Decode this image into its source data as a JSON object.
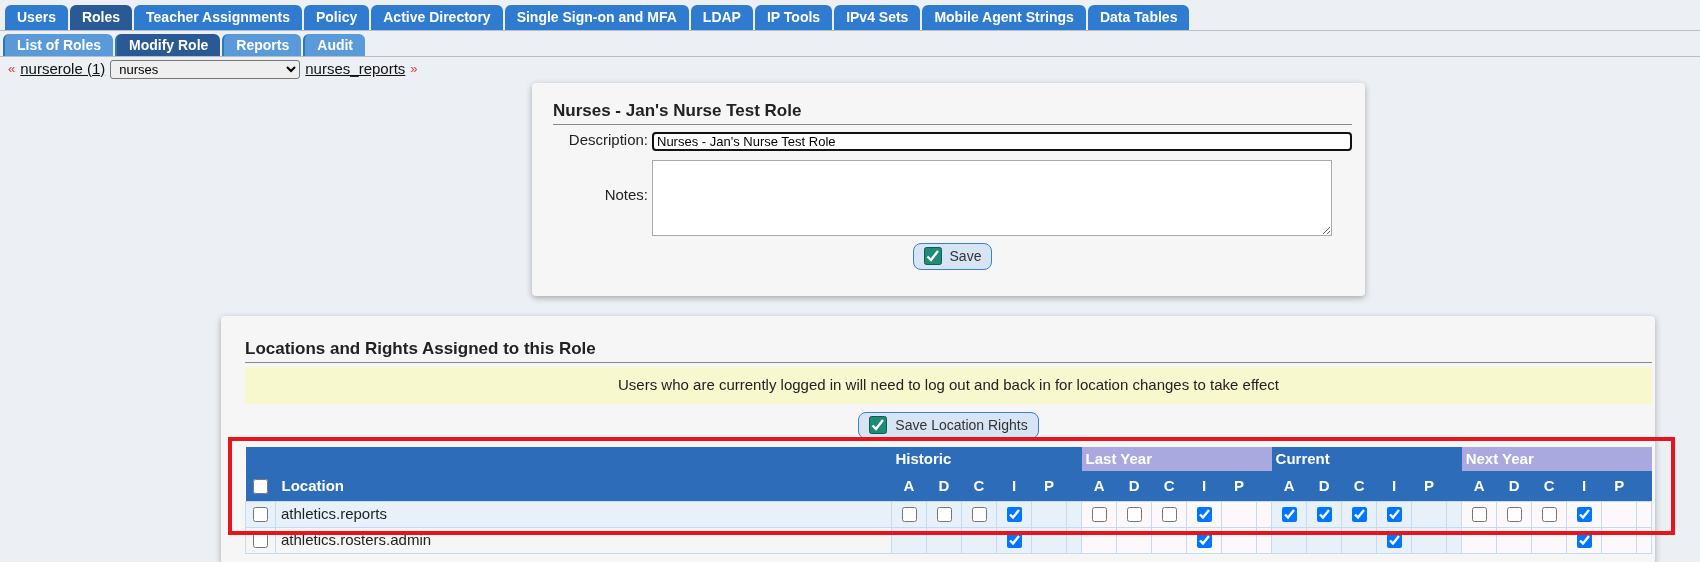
{
  "top_tabs": [
    {
      "label": "Users",
      "selected": false
    },
    {
      "label": "Roles",
      "selected": true
    },
    {
      "label": "Teacher Assignments",
      "selected": false
    },
    {
      "label": "Policy",
      "selected": false
    },
    {
      "label": "Active Directory",
      "selected": false
    },
    {
      "label": "Single Sign-on and MFA",
      "selected": false
    },
    {
      "label": "LDAP",
      "selected": false
    },
    {
      "label": "IP Tools",
      "selected": false
    },
    {
      "label": "IPv4 Sets",
      "selected": false
    },
    {
      "label": "Mobile Agent Strings",
      "selected": false
    },
    {
      "label": "Data Tables",
      "selected": false
    }
  ],
  "sub_tabs": [
    {
      "label": "List of Roles",
      "selected": false
    },
    {
      "label": "Modify Role",
      "selected": true
    },
    {
      "label": "Reports",
      "selected": false
    },
    {
      "label": "Audit",
      "selected": false
    }
  ],
  "breadcrumb": {
    "prev_marker": "«",
    "previous": "nurserole (1)",
    "select_value": "nurses",
    "next": "nurses_reports",
    "next_marker": "»"
  },
  "role_card": {
    "title": "Nurses - Jan's Nurse Test Role",
    "description_label": "Description:",
    "description_value": "Nurses - Jan's Nurse Test Role",
    "notes_label": "Notes:",
    "save_label": "Save"
  },
  "locations_card": {
    "title": "Locations and Rights Assigned to this Role",
    "notice": "Users who are currently logged in will need to log out and back in for location changes to take effect",
    "save_label": "Save Location Rights",
    "table": {
      "select_all_checked": false,
      "location_heading": "Location",
      "periods": [
        {
          "name": "Historic",
          "lavender": false,
          "rights": [
            "A",
            "D",
            "C",
            "I",
            "P"
          ]
        },
        {
          "name": "Last Year",
          "lavender": true,
          "rights": [
            "A",
            "D",
            "C",
            "I",
            "P"
          ]
        },
        {
          "name": "Current",
          "lavender": false,
          "rights": [
            "A",
            "D",
            "C",
            "I",
            "P"
          ]
        },
        {
          "name": "Next Year",
          "lavender": true,
          "rights": [
            "A",
            "D",
            "C",
            "I",
            "P"
          ]
        }
      ],
      "rows": [
        {
          "location": "athletics.reports",
          "checked": false,
          "cells": [
            [
              false,
              false,
              false,
              true,
              null
            ],
            [
              false,
              false,
              false,
              true,
              null
            ],
            [
              true,
              true,
              true,
              true,
              null
            ],
            [
              false,
              false,
              false,
              true,
              null
            ]
          ]
        },
        {
          "location": "athletics.rosters.admin",
          "checked": false,
          "cells": [
            [
              null,
              null,
              null,
              true,
              null
            ],
            [
              null,
              null,
              null,
              true,
              null
            ],
            [
              null,
              null,
              null,
              true,
              null
            ],
            [
              null,
              null,
              null,
              true,
              null
            ]
          ]
        }
      ]
    }
  }
}
